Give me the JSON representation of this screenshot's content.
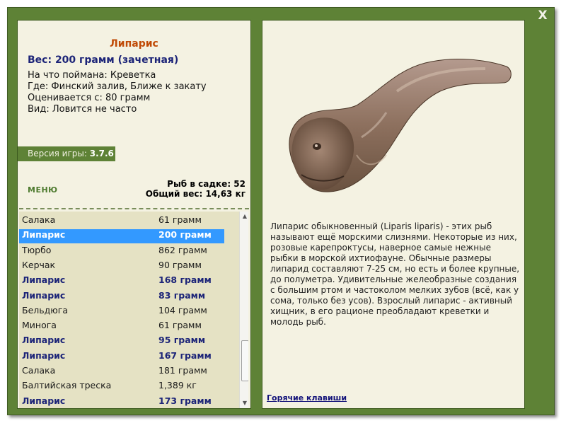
{
  "window": {
    "close_label": "X"
  },
  "fish_info": {
    "title": "Липарис",
    "weight_line": "Вес: 200 грамм (зачетная)",
    "bait_line": "На что поймана: Креветка",
    "location_line": "Где: Финский залив, Ближе к закату",
    "valued_line": "Оценивается с: 80 грамм",
    "kind_line": "Вид: Ловится не часто"
  },
  "version": {
    "label": "Версия игры: ",
    "value": "3.7.6"
  },
  "menu_label": "МЕНЮ",
  "keepnet": {
    "count_line": "Рыб в садке: 52",
    "weight_line": "Общий вес: 14,63 кг"
  },
  "catch_list": [
    {
      "name": "Салака",
      "weight": "61 грамм",
      "style": "normal"
    },
    {
      "name": "Липарис",
      "weight": "200 грамм",
      "style": "selected"
    },
    {
      "name": "Тюрбо",
      "weight": "862 грамм",
      "style": "normal"
    },
    {
      "name": "Керчак",
      "weight": "90 грамм",
      "style": "normal"
    },
    {
      "name": "Липарис",
      "weight": "168 грамм",
      "style": "bold"
    },
    {
      "name": "Липарис",
      "weight": "83 грамм",
      "style": "bold"
    },
    {
      "name": "Бельдюга",
      "weight": "104 грамм",
      "style": "normal"
    },
    {
      "name": "Минога",
      "weight": "61 грамм",
      "style": "normal"
    },
    {
      "name": "Липарис",
      "weight": "95 грамм",
      "style": "bold"
    },
    {
      "name": "Липарис",
      "weight": "167 грамм",
      "style": "bold"
    },
    {
      "name": "Салака",
      "weight": "181 грамм",
      "style": "normal"
    },
    {
      "name": "Балтийская треска",
      "weight": "1,389 кг",
      "style": "normal"
    },
    {
      "name": "Липарис",
      "weight": "173 грамм",
      "style": "bold"
    }
  ],
  "description": "Липарис обыкновенный (Liparis liparis) - этих рыб называют ещё морскими слизнями. Некоторые из них, розовые карепроктусы, наверное самые нежные рыбки в морской ихтиофауне. Обычные размеры липарид составляют 7-25 см, но есть и более крупные, до полуметра. Удивительные желеобразные создания с большим ртом и частоколом мелких зубов (всё, как у сома, только без усов). Взрослый липарис - активный хищник, в его рационе преобладают креветки и молодь рыб.",
  "hotkeys_label": "Горячие клавиши",
  "colors": {
    "frame_green": "#5e8236",
    "panel_bg": "#f4f2e2",
    "list_bg": "#e5e2c4",
    "selection_blue": "#3399ff",
    "title_orange": "#c04a06",
    "highlight_navy": "#1c2478"
  }
}
